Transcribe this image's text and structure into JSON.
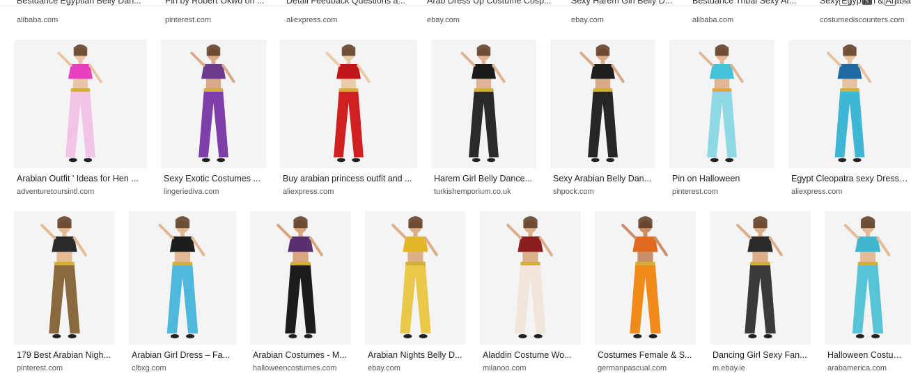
{
  "top_row": [
    {
      "title": "Bestdance Egyptian Belly Dan...",
      "source": "alibaba.com"
    },
    {
      "title": "Pin by Robert Okwu on ...",
      "source": "pinterest.com"
    },
    {
      "title": "Detail Feedback Questions a...",
      "source": "aliexpress.com"
    },
    {
      "title": "Arab Dress Up Costume Cosp...",
      "source": "ebay.com"
    },
    {
      "title": "Sexy Harem Girl Belly D...",
      "source": "ebay.com"
    },
    {
      "title": "Bestdance Tribal Sexy Ar...",
      "source": "alibaba.com"
    },
    {
      "title": "Sexy Egyptian & Arabia",
      "source": "costumediscounters.com"
    }
  ],
  "row1": [
    {
      "title": "Arabian Outfit ' Ideas for Hen ...",
      "source": "adventuretoursintl.com",
      "top": "#e83fbf",
      "bottom": "#f3c3e8",
      "skin": "#e9c5a6"
    },
    {
      "title": "Sexy Exotic Costumes ...",
      "source": "lingeriediva.com",
      "top": "#6b3b8c",
      "bottom": "#7e3fa8",
      "skin": "#d9a98a"
    },
    {
      "title": "Buy arabian princess outfit and ...",
      "source": "aliexpress.com",
      "top": "#c0161b",
      "bottom": "#d02020",
      "skin": "#eccba9"
    },
    {
      "title": "Harem Girl Belly Dance...",
      "source": "turkishemporium.co.uk",
      "top": "#1b1b1b",
      "bottom": "#2a2a2a",
      "skin": "#dfb393"
    },
    {
      "title": "Sexy Arabian Belly Dan...",
      "source": "shpock.com",
      "top": "#1e1e1e",
      "bottom": "#262626",
      "skin": "#d8aa88"
    },
    {
      "title": "Pin on Halloween",
      "source": "pinterest.com",
      "top": "#43c3d8",
      "bottom": "#8fd9e6",
      "skin": "#e3b592"
    },
    {
      "title": "Egypt Cleopatra sexy Dress La",
      "source": "aliexpress.com",
      "top": "#1e6aa0",
      "bottom": "#3fb7d4",
      "skin": "#e7c2a1"
    }
  ],
  "row2": [
    {
      "title": "179 Best Arabian Nigh...",
      "source": "pinterest.com",
      "top": "#2a2a2a",
      "bottom": "#8a6a3c",
      "skin": "#e5bb95"
    },
    {
      "title": "Arabian Girl Dress – Fa...",
      "source": "clbxg.com",
      "top": "#1d1d1d",
      "bottom": "#4fb8dd",
      "skin": "#e2b995"
    },
    {
      "title": "Arabian Costumes - M...",
      "source": "halloweencostumes.com",
      "top": "#5a2f6f",
      "bottom": "#1c1c1c",
      "skin": "#d9a67f"
    },
    {
      "title": "Arabian Nights Belly D...",
      "source": "ebay.com",
      "top": "#e1b628",
      "bottom": "#e9c84a",
      "skin": "#dcae89"
    },
    {
      "title": "Aladdin Costume Wo...",
      "source": "milanoo.com",
      "top": "#8a1d1d",
      "bottom": "#f0e6dc",
      "skin": "#ddb08c"
    },
    {
      "title": "Costumes Female & S...",
      "source": "germanpascual.com",
      "top": "#e06a1f",
      "bottom": "#f08a18",
      "skin": "#c98f67"
    },
    {
      "title": "Dancing Girl Sexy Fan...",
      "source": "m.ebay.ie",
      "top": "#2a2a2a",
      "bottom": "#3a3a3a",
      "skin": "#dcae8a"
    },
    {
      "title": "Halloween Costumes",
      "source": "arabamerica.com",
      "top": "#40b6cf",
      "bottom": "#58c4d8",
      "skin": "#e5bc98"
    }
  ]
}
